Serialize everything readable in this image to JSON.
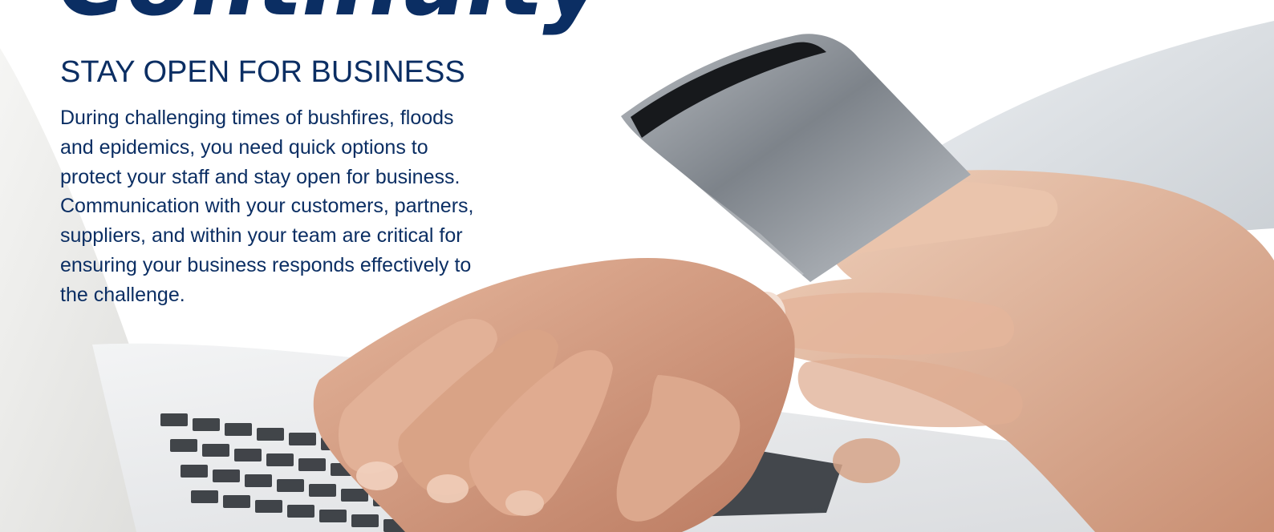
{
  "headline": "Continuity",
  "subheading": "STAY OPEN FOR BUSINESS",
  "body": "During challenging times of bushfires, floods and epidemics, you need quick options to protect your staff and stay open for business. Communication with your customers, partners, suppliers, and within your team are critical for ensuring your business responds effectively to the challenge.",
  "colors": {
    "text": "#0b2e63",
    "background": "#ffffff"
  },
  "image": {
    "icon": "hands-phone-laptop-photo"
  }
}
